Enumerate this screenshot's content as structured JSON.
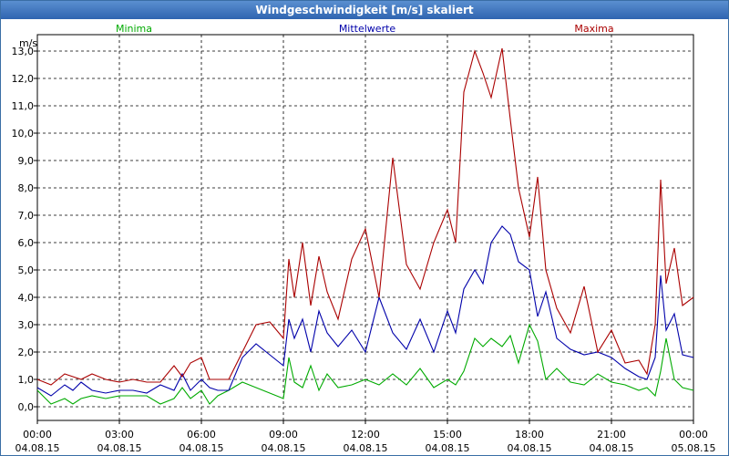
{
  "window": {
    "title": "Windgeschwindigkeit [m/s] skaliert"
  },
  "chart_data": {
    "type": "line",
    "title": "Windgeschwindigkeit [m/s] skaliert",
    "ylabel": "m/s",
    "xlabel": "",
    "ylim": [
      -0.5,
      13.6
    ],
    "xlim": [
      0,
      24
    ],
    "grid": true,
    "legend_position": "top",
    "y_ticks": [
      "0,0",
      "1,0",
      "2,0",
      "3,0",
      "4,0",
      "5,0",
      "6,0",
      "7,0",
      "8,0",
      "9,0",
      "10,0",
      "11,0",
      "12,0",
      "13,0"
    ],
    "x_ticks": [
      {
        "time": "00:00",
        "date": "04.08.15"
      },
      {
        "time": "03:00",
        "date": "04.08.15"
      },
      {
        "time": "06:00",
        "date": "04.08.15"
      },
      {
        "time": "09:00",
        "date": "04.08.15"
      },
      {
        "time": "12:00",
        "date": "04.08.15"
      },
      {
        "time": "15:00",
        "date": "04.08.15"
      },
      {
        "time": "18:00",
        "date": "04.08.15"
      },
      {
        "time": "21:00",
        "date": "04.08.15"
      },
      {
        "time": "00:00",
        "date": "05.08.15"
      }
    ],
    "series": [
      {
        "name": "Minima",
        "color": "#00aa00",
        "x": [
          0,
          0.5,
          1,
          1.3,
          1.6,
          2,
          2.5,
          3,
          3.5,
          4,
          4.5,
          5,
          5.3,
          5.6,
          6,
          6.3,
          6.6,
          7,
          7.5,
          8,
          8.5,
          9,
          9.2,
          9.4,
          9.7,
          10,
          10.3,
          10.6,
          11,
          11.5,
          12,
          12.5,
          13,
          13.5,
          14,
          14.5,
          15,
          15.3,
          15.6,
          16,
          16.3,
          16.6,
          17,
          17.3,
          17.6,
          18,
          18.3,
          18.6,
          19,
          19.5,
          20,
          20.5,
          21,
          21.5,
          22,
          22.3,
          22.6,
          22.8,
          23,
          23.3,
          23.6,
          24
        ],
        "y": [
          0.6,
          0.1,
          0.3,
          0.1,
          0.3,
          0.4,
          0.3,
          0.4,
          0.4,
          0.4,
          0.1,
          0.3,
          0.7,
          0.3,
          0.6,
          0.1,
          0.4,
          0.6,
          0.9,
          0.7,
          0.5,
          0.3,
          1.8,
          0.9,
          0.7,
          1.5,
          0.6,
          1.2,
          0.7,
          0.8,
          1.0,
          0.8,
          1.2,
          0.8,
          1.4,
          0.7,
          1.0,
          0.8,
          1.3,
          2.5,
          2.2,
          2.5,
          2.2,
          2.6,
          1.6,
          3.0,
          2.4,
          1.0,
          1.4,
          0.9,
          0.8,
          1.2,
          0.9,
          0.8,
          0.6,
          0.7,
          0.4,
          1.3,
          2.5,
          1.0,
          0.7,
          0.6
        ]
      },
      {
        "name": "Mittelwerte",
        "color": "#0000aa",
        "x": [
          0,
          0.5,
          1,
          1.3,
          1.6,
          2,
          2.5,
          3,
          3.5,
          4,
          4.5,
          5,
          5.3,
          5.6,
          6,
          6.3,
          6.6,
          7,
          7.5,
          8,
          8.5,
          9,
          9.2,
          9.4,
          9.7,
          10,
          10.3,
          10.6,
          11,
          11.5,
          12,
          12.5,
          13,
          13.5,
          14,
          14.5,
          15,
          15.3,
          15.6,
          16,
          16.3,
          16.6,
          17,
          17.3,
          17.6,
          18,
          18.3,
          18.6,
          19,
          19.5,
          20,
          20.5,
          21,
          21.5,
          22,
          22.3,
          22.6,
          22.8,
          23,
          23.3,
          23.6,
          24
        ],
        "y": [
          0.7,
          0.4,
          0.8,
          0.6,
          0.9,
          0.6,
          0.5,
          0.6,
          0.6,
          0.5,
          0.8,
          0.6,
          1.2,
          0.6,
          1.0,
          0.7,
          0.6,
          0.6,
          1.8,
          2.3,
          1.9,
          1.5,
          3.2,
          2.5,
          3.2,
          2.0,
          3.5,
          2.7,
          2.2,
          2.8,
          2.0,
          4.0,
          2.7,
          2.1,
          3.2,
          2.0,
          3.5,
          2.7,
          4.3,
          5.0,
          4.5,
          6.0,
          6.6,
          6.3,
          5.3,
          5.0,
          3.3,
          4.2,
          2.5,
          2.1,
          1.9,
          2.0,
          1.8,
          1.4,
          1.1,
          1.0,
          1.8,
          4.8,
          2.8,
          3.4,
          1.9,
          1.8
        ]
      },
      {
        "name": "Maxima",
        "color": "#aa0000",
        "x": [
          0,
          0.5,
          1,
          1.3,
          1.6,
          2,
          2.5,
          3,
          3.5,
          4,
          4.5,
          5,
          5.3,
          5.6,
          6,
          6.3,
          6.6,
          7,
          7.5,
          8,
          8.5,
          9,
          9.2,
          9.4,
          9.7,
          10,
          10.3,
          10.6,
          11,
          11.5,
          12,
          12.5,
          13,
          13.5,
          14,
          14.5,
          15,
          15.3,
          15.6,
          16,
          16.3,
          16.6,
          17,
          17.3,
          17.6,
          18,
          18.3,
          18.6,
          19,
          19.5,
          20,
          20.5,
          21,
          21.5,
          22,
          22.3,
          22.6,
          22.8,
          23,
          23.3,
          23.6,
          24
        ],
        "y": [
          1.0,
          0.8,
          1.2,
          1.1,
          1.0,
          1.2,
          1.0,
          0.9,
          1.0,
          0.9,
          0.9,
          1.5,
          1.1,
          1.6,
          1.8,
          1.0,
          1.0,
          1.0,
          2.0,
          3.0,
          3.1,
          2.5,
          5.4,
          4.0,
          6.0,
          3.7,
          5.5,
          4.2,
          3.2,
          5.4,
          6.5,
          4.0,
          9.1,
          5.2,
          4.3,
          6.0,
          7.2,
          6.0,
          11.5,
          13.0,
          12.2,
          11.3,
          13.1,
          10.5,
          8.0,
          6.2,
          8.4,
          5.0,
          3.6,
          2.7,
          4.4,
          2.0,
          2.8,
          1.6,
          1.7,
          1.2,
          3.0,
          8.3,
          4.5,
          5.8,
          3.7,
          4.0
        ]
      }
    ]
  }
}
